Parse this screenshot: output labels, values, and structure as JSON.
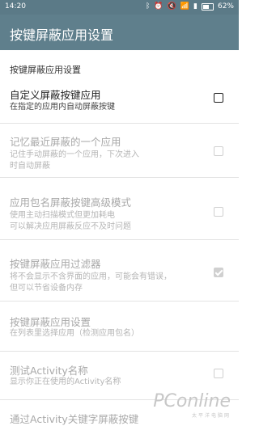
{
  "status_bar": {
    "time": "14:20",
    "battery": "62%",
    "icons": [
      "bluetooth-icon",
      "alarm-icon",
      "mute-icon",
      "wifi-icon",
      "signal-icon",
      "battery-icon"
    ]
  },
  "app_bar": {
    "title": "按键屏蔽应用设置"
  },
  "section": {
    "header": "按键屏蔽应用设置"
  },
  "prefs": [
    {
      "title": "自定义屏蔽按键应用",
      "summary_lines": [
        "在指定的应用内自动屏蔽按键"
      ],
      "enabled": true,
      "checked": false
    },
    {
      "title": "记忆最近屏蔽的一个应用",
      "summary_lines": [
        "记住手动屏蔽的一个应用，下次进入",
        "时自动屏蔽"
      ],
      "enabled": false,
      "checked": false
    },
    {
      "title": "应用包名屏蔽按键高级模式",
      "summary_lines": [
        "使用主动扫描模式但更加耗电",
        "可以解决应用屏蔽反应不及时问题"
      ],
      "enabled": false,
      "checked": false
    },
    {
      "title": "按键屏蔽应用过滤器",
      "summary_lines": [
        "将不会显示不含界面的应用，可能会有错误，",
        "但可以节省设备内存"
      ],
      "enabled": false,
      "checked": true
    },
    {
      "title": "按键屏蔽应用设置",
      "summary_lines": [
        "在列表里选择应用（检测应用包名）"
      ],
      "enabled": false,
      "checked": null
    },
    {
      "title": "测试Activity名称",
      "summary_lines": [
        "显示你正在使用的Activity名称"
      ],
      "enabled": false,
      "checked": false
    },
    {
      "title": "通过Activity关键字屏蔽按键",
      "summary_lines": [],
      "enabled": false,
      "checked": null
    }
  ],
  "watermark": {
    "logo": "PConline",
    "sub": "太平洋电脑网"
  },
  "colors": {
    "status_bar": "#5b7a87",
    "app_bar": "#5f7f8c",
    "disabled_text": "#a9a9a9"
  }
}
